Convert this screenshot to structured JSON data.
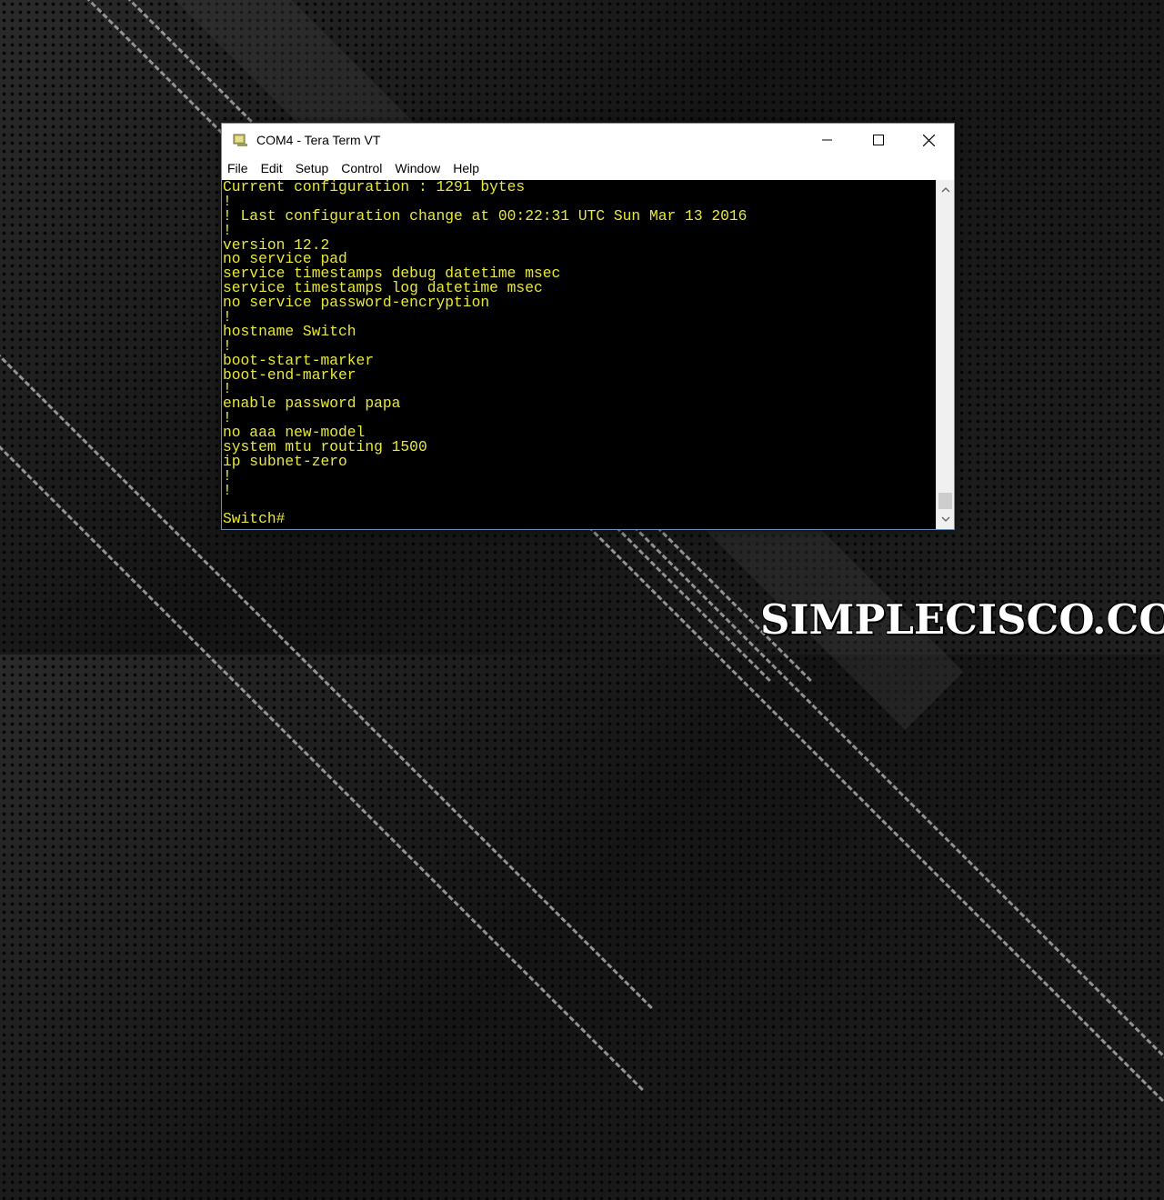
{
  "window": {
    "title": "COM4 - Tera Term VT"
  },
  "menu": [
    "File",
    "Edit",
    "Setup",
    "Control",
    "Window",
    "Help"
  ],
  "terminal": {
    "lines": [
      "Current configuration : 1291 bytes",
      "!",
      "! Last configuration change at 00:22:31 UTC Sun Mar 13 2016",
      "!",
      "version 12.2",
      "no service pad",
      "service timestamps debug datetime msec",
      "service timestamps log datetime msec",
      "no service password-encryption",
      "!",
      "hostname Switch",
      "!",
      "boot-start-marker",
      "boot-end-marker",
      "!",
      "enable password papa",
      "!",
      "no aaa new-model",
      "system mtu routing 1500",
      "ip subnet-zero",
      "!",
      "!",
      "",
      "Switch#"
    ],
    "text_color": "#e8e83a",
    "background": "#000000"
  },
  "watermark": {
    "text": "SIMPLECISCO.COM"
  }
}
